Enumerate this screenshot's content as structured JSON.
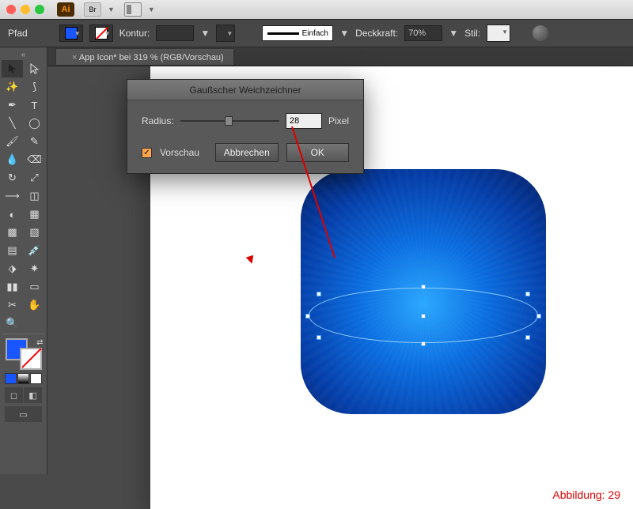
{
  "app": {
    "badge": "Ai",
    "bridge": "Br"
  },
  "controlbar": {
    "selection_label": "Pfad",
    "stroke_label": "Kontur:",
    "stroke_value": "",
    "stroke_style": "Einfach",
    "opacity_label": "Deckkraft:",
    "opacity_value": "70%",
    "style_label": "Stil:"
  },
  "document": {
    "tab_title": "App Icon* bei 319 % (RGB/Vorschau)"
  },
  "dialog": {
    "title": "Gaußscher Weichzeichner",
    "radius_label": "Radius:",
    "radius_value": "28",
    "unit": "Pixel",
    "preview_label": "Vorschau",
    "cancel": "Abbrechen",
    "ok": "OK"
  },
  "colors": {
    "fill": "#1a56ff"
  },
  "caption": "Abbildung: 29"
}
